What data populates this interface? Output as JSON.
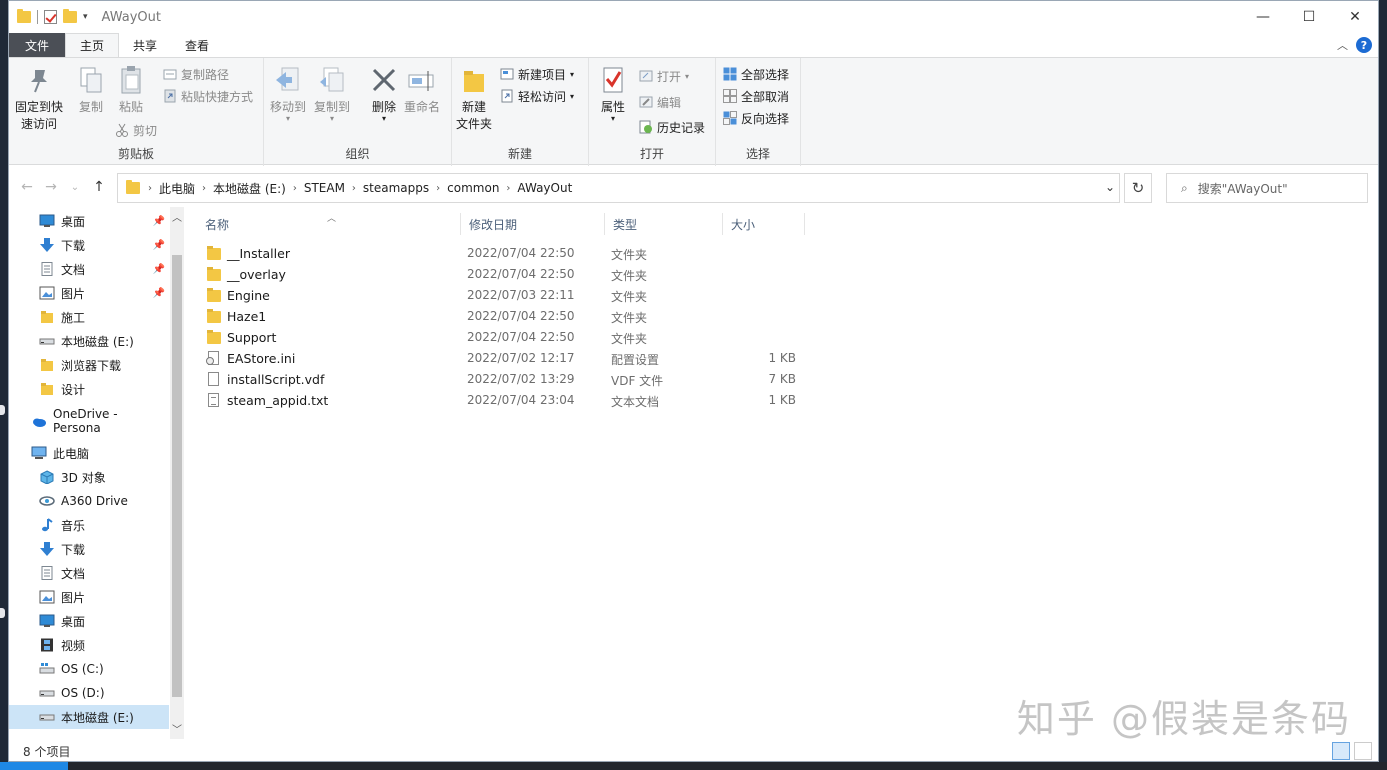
{
  "window": {
    "title": "AWayOut",
    "minimize": "—",
    "maximize": "☐",
    "close": "✕"
  },
  "ribbon_tabs": [
    {
      "label": "文件"
    },
    {
      "label": "主页"
    },
    {
      "label": "共享"
    },
    {
      "label": "查看"
    }
  ],
  "ribbon": {
    "clipboard": {
      "pin_label_1": "固定到快",
      "pin_label_2": "速访问",
      "copy": "复制",
      "paste": "粘贴",
      "copy_path": "复制路径",
      "paste_shortcut": "粘贴快捷方式",
      "cut": "剪切",
      "group": "剪贴板"
    },
    "organize": {
      "move_to": "移动到",
      "copy_to": "复制到",
      "delete": "删除",
      "rename": "重命名",
      "group": "组织"
    },
    "new": {
      "new_folder_1": "新建",
      "new_folder_2": "文件夹",
      "new_item": "新建项目",
      "easy_access": "轻松访问",
      "group": "新建"
    },
    "open": {
      "properties": "属性",
      "open": "打开",
      "edit": "编辑",
      "history": "历史记录",
      "group": "打开"
    },
    "select": {
      "select_all": "全部选择",
      "select_none": "全部取消",
      "invert": "反向选择",
      "group": "选择"
    }
  },
  "address": {
    "crumbs": [
      "此电脑",
      "本地磁盘 (E:)",
      "STEAM",
      "steamapps",
      "common",
      "AWayOut"
    ],
    "search_placeholder": "搜索\"AWayOut\""
  },
  "nav": {
    "quick": [
      {
        "label": "桌面",
        "pinned": true
      },
      {
        "label": "下载",
        "pinned": true
      },
      {
        "label": "文档",
        "pinned": true
      },
      {
        "label": "图片",
        "pinned": true
      },
      {
        "label": "施工"
      },
      {
        "label": "本地磁盘 (E:)"
      },
      {
        "label": "浏览器下载"
      },
      {
        "label": "设计"
      }
    ],
    "onedrive": "OneDrive - Persona",
    "thispc": "此电脑",
    "pc_items": [
      {
        "label": "3D 对象"
      },
      {
        "label": "A360 Drive"
      },
      {
        "label": "音乐"
      },
      {
        "label": "下载"
      },
      {
        "label": "文档"
      },
      {
        "label": "图片"
      },
      {
        "label": "桌面"
      },
      {
        "label": "视频"
      },
      {
        "label": "OS (C:)"
      },
      {
        "label": "OS (D:)"
      },
      {
        "label": "本地磁盘 (E:)"
      }
    ]
  },
  "columns": {
    "name": "名称",
    "date": "修改日期",
    "type": "类型",
    "size": "大小"
  },
  "files": [
    {
      "name": "__Installer",
      "date": "2022/07/04 22:50",
      "type": "文件夹",
      "size": "",
      "icon": "folder"
    },
    {
      "name": "__overlay",
      "date": "2022/07/04 22:50",
      "type": "文件夹",
      "size": "",
      "icon": "folder"
    },
    {
      "name": "Engine",
      "date": "2022/07/03 22:11",
      "type": "文件夹",
      "size": "",
      "icon": "folder"
    },
    {
      "name": "Haze1",
      "date": "2022/07/04 22:50",
      "type": "文件夹",
      "size": "",
      "icon": "folder"
    },
    {
      "name": "Support",
      "date": "2022/07/04 22:50",
      "type": "文件夹",
      "size": "",
      "icon": "folder"
    },
    {
      "name": "EAStore.ini",
      "date": "2022/07/02 12:17",
      "type": "配置设置",
      "size": "1 KB",
      "icon": "ini"
    },
    {
      "name": "installScript.vdf",
      "date": "2022/07/02 13:29",
      "type": "VDF 文件",
      "size": "7 KB",
      "icon": "doc"
    },
    {
      "name": "steam_appid.txt",
      "date": "2022/07/04 23:04",
      "type": "文本文档",
      "size": "1 KB",
      "icon": "txt"
    }
  ],
  "status": {
    "count": "8 个项目"
  },
  "watermark": "知乎 @假装是条码"
}
